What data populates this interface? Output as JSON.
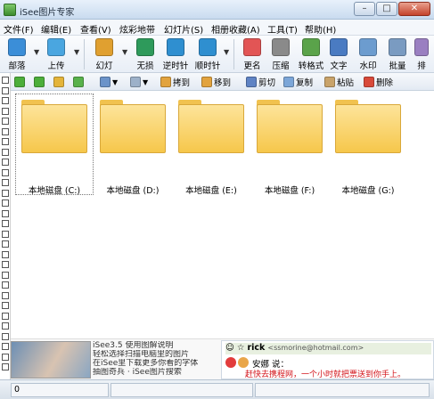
{
  "window": {
    "title": "iSee图片专家",
    "buttons": {
      "minimize": "–",
      "maximize": "□",
      "close": "✕"
    }
  },
  "menu": [
    "文件(F)",
    "编辑(E)",
    "查看(V)",
    "炫彩地带",
    "幻灯片(S)",
    "相册收藏(A)",
    "工具(T)",
    "帮助(H)"
  ],
  "toolbar": [
    {
      "label": "部落",
      "icon": "tribe-icon",
      "color": "#3b8ed8"
    },
    {
      "label": "上传",
      "icon": "upload-icon",
      "color": "#4aa6e0"
    },
    {
      "label": "幻灯",
      "icon": "slideshow-icon",
      "color": "#e0a030"
    },
    {
      "label": "无损",
      "icon": "lossless-rotate-icon",
      "color": "#2e9a5b"
    },
    {
      "label": "逆时针",
      "icon": "rotate-ccw-icon",
      "color": "#2f8fd0"
    },
    {
      "label": "顺时针",
      "icon": "rotate-cw-icon",
      "color": "#2f8fd0"
    },
    {
      "label": "更名",
      "icon": "rename-icon",
      "color": "#e25555"
    },
    {
      "label": "压缩",
      "icon": "compress-icon",
      "color": "#8a8a8a"
    },
    {
      "label": "转格式",
      "icon": "convert-format-icon",
      "color": "#5aa34a"
    },
    {
      "label": "文字",
      "icon": "text-icon",
      "color": "#4a7bc2"
    },
    {
      "label": "水印",
      "icon": "watermark-icon",
      "color": "#6c9ccf"
    },
    {
      "label": "批量",
      "icon": "batch-icon",
      "color": "#7a9bc1"
    },
    {
      "label": "排",
      "icon": "arrange-icon",
      "color": "#9a7fc1"
    }
  ],
  "toolbar2": {
    "copy_to": "拷到",
    "move_to": "移到",
    "cut": "剪切",
    "copy": "复制",
    "paste": "粘贴",
    "delete": "删除"
  },
  "drives": [
    {
      "label": "本地磁盘 (C:)",
      "selected": true
    },
    {
      "label": "本地磁盘 (D:)",
      "selected": false
    },
    {
      "label": "本地磁盘 (E:)",
      "selected": false
    },
    {
      "label": "本地磁盘 (F:)",
      "selected": false
    },
    {
      "label": "本地磁盘 (G:)",
      "selected": false
    }
  ],
  "ad": {
    "lines": [
      "iSee3.5 使用图解说明",
      "轻松选择扫描电脑里的图片",
      "在iSee里下载更多你看的字体",
      "抽图奇兵 · iSee图片搜索"
    ]
  },
  "chat": {
    "user": "rick",
    "email": "<ssmorine@hotmail.com>",
    "who": "安娜  说：",
    "message": "赶快去携程网，一个小时就把票送到你手上。"
  },
  "status": {
    "count": "0"
  }
}
